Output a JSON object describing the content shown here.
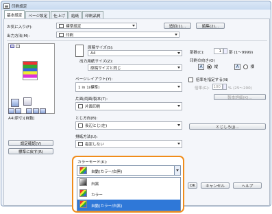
{
  "window": {
    "title": "印刷設定"
  },
  "tabs": [
    "基本設定",
    "ページ設定",
    "仕上げ",
    "給紙",
    "印刷品質"
  ],
  "profile": {
    "label": "お気に入り(F):",
    "value": "標準設定",
    "add_button": "追加(1)...",
    "edit_button": "編集(2)..."
  },
  "output_method": {
    "label": "出力方法(M):",
    "value": "印刷"
  },
  "preview": {
    "caption": "A4(原寸)[自動]",
    "settings_button": "設定確認(V)",
    "restore_button": "標準に戻す(R)"
  },
  "paper_size": {
    "label": "原稿サイズ(S):",
    "value": "A4"
  },
  "output_size": {
    "label": "出力用紙サイズ(Z):",
    "value": "原稿サイズと同じ"
  },
  "page_layout": {
    "label": "ページレイアウト(Y):",
    "value": "1 in 1(標準)"
  },
  "duplex": {
    "label": "片面/両面/製本(T):",
    "value": "片面印刷"
  },
  "binding": {
    "label": "とじ方向(B):",
    "value": "長辺とじ(左)"
  },
  "discharge": {
    "label": "排紙方法(U):",
    "value": "指定しない"
  },
  "copies": {
    "label": "部数(C):",
    "value": "1",
    "range": "部 (1〜9999)"
  },
  "orientation": {
    "label": "印刷の向き(O)",
    "portrait": "縦",
    "landscape": "横"
  },
  "scale": {
    "check_label": "倍率を指定する(N)",
    "field_label": "倍率(G):",
    "value": "100",
    "range": "% (25〜200)"
  },
  "gutter_button": "製本詳細(K)...",
  "binding_button": "とじしろ(J)...",
  "color_mode": {
    "label": "カラーモード(K):",
    "value": "自動(カラー/白黒)",
    "options": [
      "白黒",
      "カラー",
      "自動(カラー/白黒)"
    ]
  },
  "bottom_buttons": {
    "ok": "OK",
    "cancel": "キャンセル",
    "help": "ヘルプ"
  }
}
